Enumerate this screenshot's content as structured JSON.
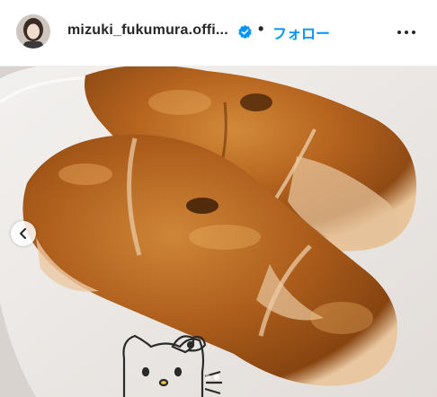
{
  "header": {
    "username": "mizuki_fukumura.offi...",
    "separator": "•",
    "follow_label": "フォロー"
  },
  "icons": {
    "verified": "verified-badge-icon",
    "more": "more-options-icon",
    "prev": "chevron-left-icon"
  },
  "colors": {
    "follow": "#0095f6",
    "verified": "#0095f6",
    "username": "#262626"
  },
  "carousel": {
    "slide_count": 2,
    "active_index": 1
  }
}
